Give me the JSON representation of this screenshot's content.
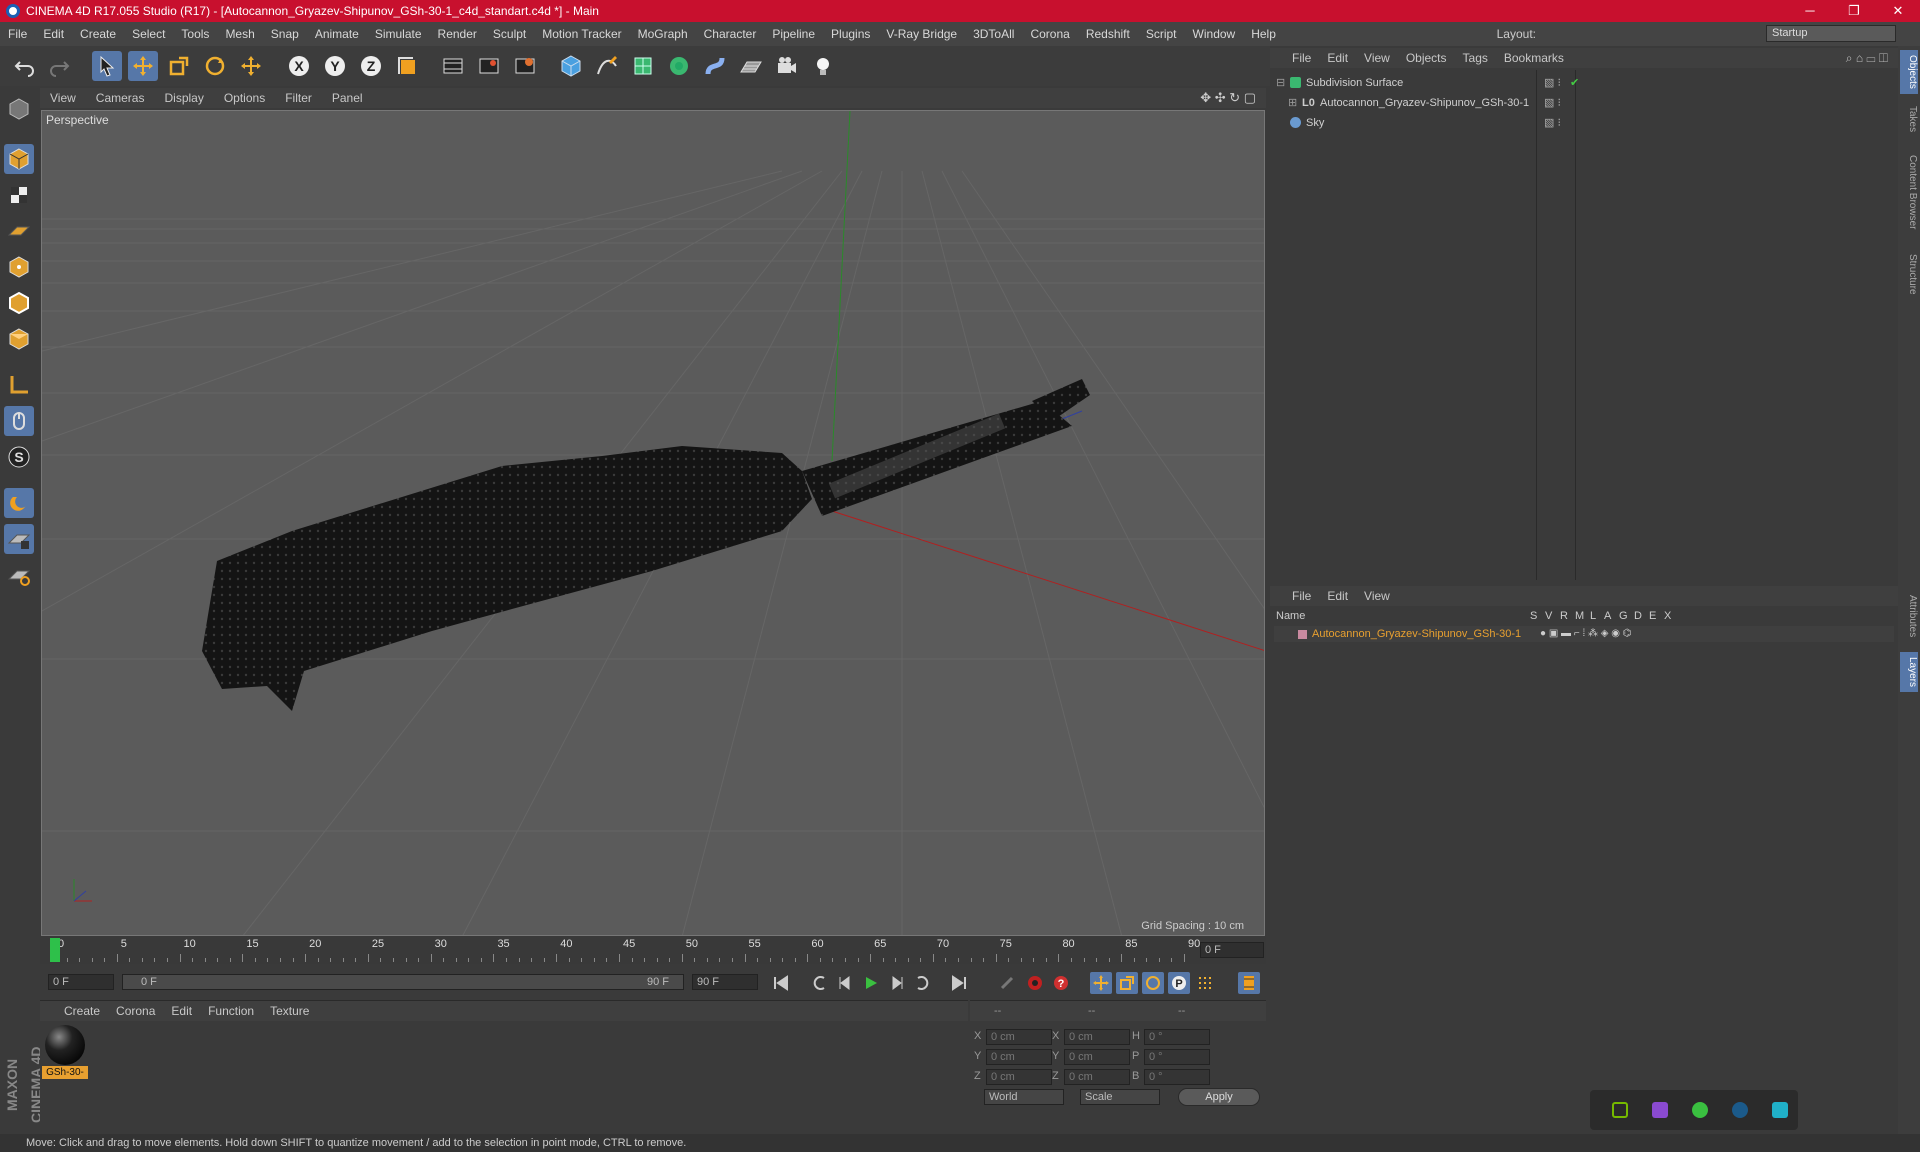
{
  "window": {
    "title": "CINEMA 4D R17.055 Studio (R17) - [Autocannon_Gryazev-Shipunov_GSh-30-1_c4d_standart.c4d *] - Main",
    "minimize": "─",
    "maximize": "❐",
    "close": "✕"
  },
  "menubar": {
    "items": [
      "File",
      "Edit",
      "Create",
      "Select",
      "Tools",
      "Mesh",
      "Snap",
      "Animate",
      "Simulate",
      "Render",
      "Sculpt",
      "Motion Tracker",
      "MoGraph",
      "Character",
      "Pipeline",
      "Plugins",
      "V-Ray Bridge",
      "3DToAll",
      "Corona",
      "Redshift",
      "Script",
      "Window",
      "Help"
    ],
    "layout_label": "Layout:",
    "layout_value": "Startup"
  },
  "viewport": {
    "menu": [
      "View",
      "Cameras",
      "Display",
      "Options",
      "Filter",
      "Panel"
    ],
    "label": "Perspective",
    "grid_spacing": "Grid Spacing : 10 cm"
  },
  "timeline": {
    "ticks": [
      "0",
      "5",
      "10",
      "15",
      "20",
      "25",
      "30",
      "35",
      "40",
      "45",
      "50",
      "55",
      "60",
      "65",
      "70",
      "75",
      "80",
      "85",
      "90"
    ],
    "current_frame": "0 F",
    "start_field": "0 F",
    "range_start": "0 F",
    "range_end": "90 F",
    "end_field": "90 F"
  },
  "materials": {
    "menu": [
      "Create",
      "Corona",
      "Edit",
      "Function",
      "Texture"
    ],
    "items": [
      {
        "name": "GSh-30-"
      }
    ]
  },
  "coords": {
    "headers": [
      "--",
      "--",
      "--"
    ],
    "rows": [
      {
        "a": "X",
        "av": "0 cm",
        "b": "X",
        "bv": "0 cm",
        "c": "H",
        "cv": "0 °"
      },
      {
        "a": "Y",
        "av": "0 cm",
        "b": "Y",
        "bv": "0 cm",
        "c": "P",
        "cv": "0 °"
      },
      {
        "a": "Z",
        "av": "0 cm",
        "b": "Z",
        "bv": "0 cm",
        "c": "B",
        "cv": "0 °"
      }
    ],
    "space": "World",
    "mode": "Scale",
    "apply": "Apply"
  },
  "objects": {
    "menu": [
      "File",
      "Edit",
      "View",
      "Objects",
      "Tags",
      "Bookmarks"
    ],
    "items": [
      {
        "name": "Subdivision Surface"
      },
      {
        "name": "Autocannon_Gryazev-Shipunov_GSh-30-1"
      },
      {
        "name": "Sky"
      }
    ]
  },
  "layers": {
    "menu": [
      "File",
      "Edit",
      "View"
    ],
    "columns": [
      "Name",
      "S",
      "V",
      "R",
      "M",
      "L",
      "A",
      "G",
      "D",
      "E",
      "X"
    ],
    "items": [
      {
        "name": "Autocannon_Gryazev-Shipunov_GSh-30-1",
        "color": "#c98aa0"
      }
    ]
  },
  "sidetabs": [
    "Objects",
    "Takes",
    "Content Browser",
    "Structure",
    "Attributes",
    "Layers"
  ],
  "status": "Move: Click and drag to move elements. Hold down SHIFT to quantize movement / add to the selection in point mode, CTRL to remove.",
  "maxon_logo": "MAXON CINEMA 4D",
  "colors": {
    "accent": "#5677a8",
    "title_bar": "#c8102e",
    "layer_name": "#e8a030"
  }
}
